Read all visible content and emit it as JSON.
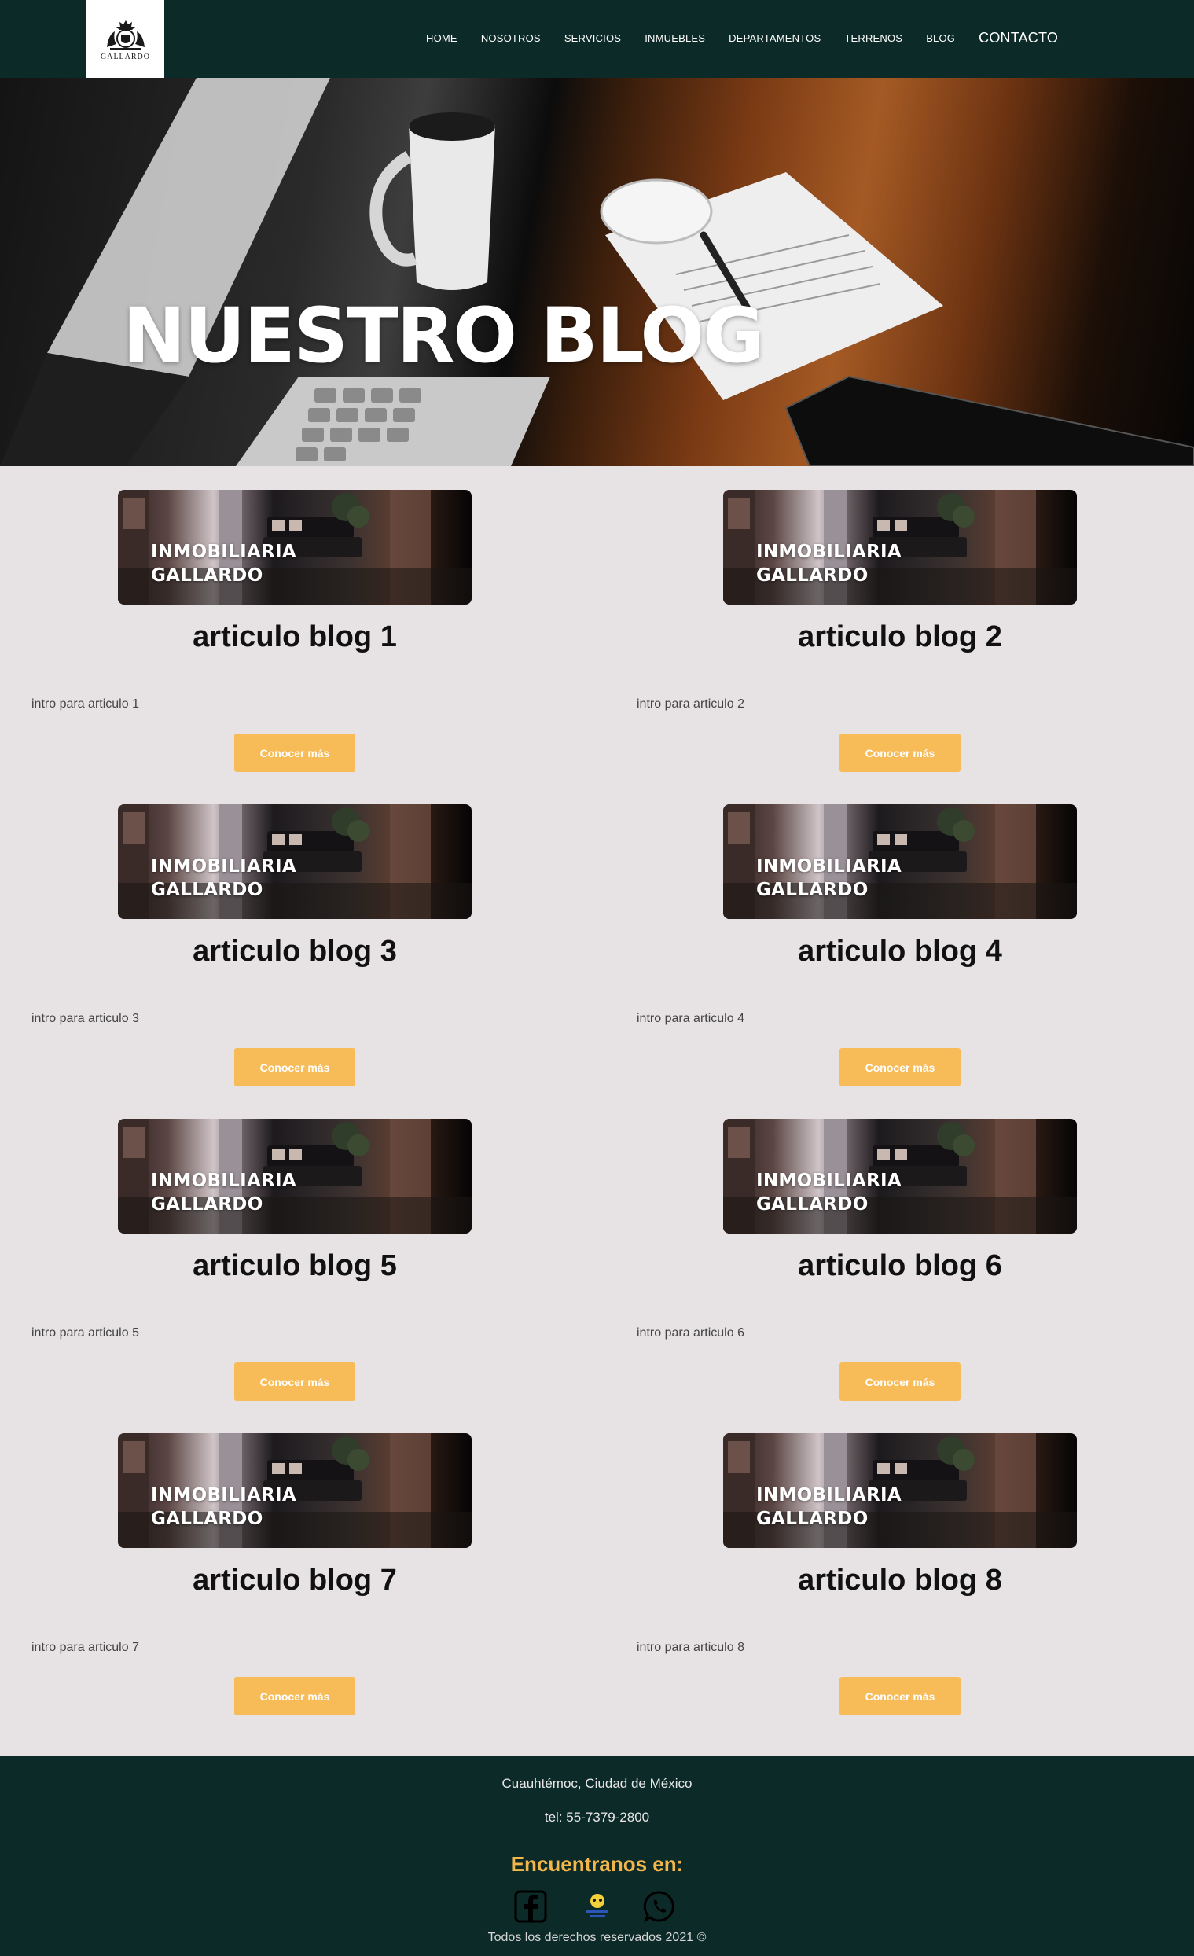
{
  "header": {
    "logo_text": "GALLARDO",
    "nav": [
      "HOME",
      "NOSOTROS",
      "SERVICIOS",
      "INMUEBLES",
      "DEPARTAMENTOS",
      "TERRENOS",
      "BLOG",
      "CONTACTO"
    ]
  },
  "hero": {
    "title": "NUESTRO BLOG"
  },
  "articles": [
    {
      "image_text": [
        "INMOBILIARIA",
        "GALLARDO"
      ],
      "title": "articulo blog 1",
      "intro": "intro para articulo 1",
      "button": "Conocer más"
    },
    {
      "image_text": [
        "INMOBILIARIA",
        "GALLARDO"
      ],
      "title": "articulo blog 2",
      "intro": "intro para articulo 2",
      "button": "Conocer más"
    },
    {
      "image_text": [
        "INMOBILIARIA",
        "GALLARDO"
      ],
      "title": "articulo blog 3",
      "intro": "intro para articulo 3",
      "button": "Conocer más"
    },
    {
      "image_text": [
        "INMOBILIARIA",
        "GALLARDO"
      ],
      "title": "articulo blog 4",
      "intro": "intro para articulo 4",
      "button": "Conocer más"
    },
    {
      "image_text": [
        "INMOBILIARIA",
        "GALLARDO"
      ],
      "title": "articulo blog 5",
      "intro": "intro para articulo 5",
      "button": "Conocer más"
    },
    {
      "image_text": [
        "INMOBILIARIA",
        "GALLARDO"
      ],
      "title": "articulo blog 6",
      "intro": "intro para articulo 6",
      "button": "Conocer más"
    },
    {
      "image_text": [
        "INMOBILIARIA",
        "GALLARDO"
      ],
      "title": "articulo blog 7",
      "intro": "intro para articulo 7",
      "button": "Conocer más"
    },
    {
      "image_text": [
        "INMOBILIARIA",
        "GALLARDO"
      ],
      "title": "articulo blog 8",
      "intro": "intro para articulo 8",
      "button": "Conocer más"
    }
  ],
  "footer": {
    "address": "Cuauhtémoc, Ciudad de México",
    "phone": "tel: 55-7379-2800",
    "heading": "Encuentranos en:",
    "social": [
      "facebook-icon",
      "marketplace-badge-icon",
      "whatsapp-icon"
    ],
    "rights": "Todos los derechos reservados 2021 ©"
  },
  "colors": {
    "nav_bg": "#0c2a27",
    "page_bg": "#e7e3e4",
    "button": "#f7bb58",
    "footer_heading": "#f3b64a"
  }
}
